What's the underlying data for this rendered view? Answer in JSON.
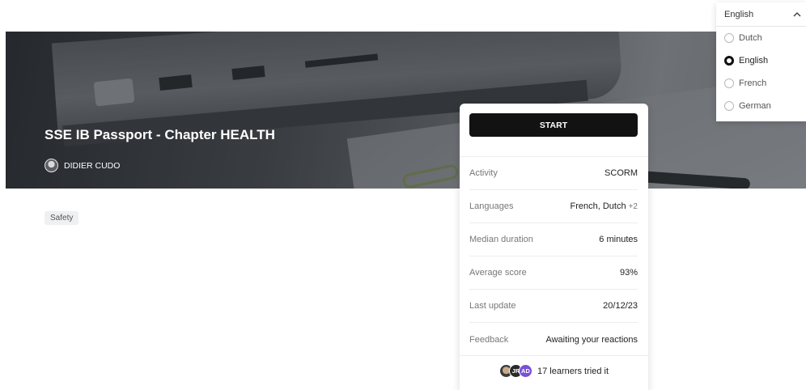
{
  "course": {
    "title": "SSE IB Passport - Chapter HEALTH",
    "author": "DIDIER CUDO",
    "tag": "Safety"
  },
  "card": {
    "start_label": "START",
    "rows": [
      {
        "key": "Activity",
        "value": "SCORM",
        "extra": ""
      },
      {
        "key": "Languages",
        "value": "French, Dutch",
        "extra": "+2"
      },
      {
        "key": "Median duration",
        "value": "6 minutes",
        "extra": ""
      },
      {
        "key": "Average score",
        "value": "93%",
        "extra": ""
      },
      {
        "key": "Last update",
        "value": "20/12/23",
        "extra": ""
      },
      {
        "key": "Feedback",
        "value": "Awaiting your reactions",
        "extra": ""
      }
    ],
    "learners": {
      "avatar_initials": [
        "JR",
        "AD"
      ],
      "label": "17 learners tried it"
    }
  },
  "language_dropdown": {
    "selected": "English",
    "options": [
      "Dutch",
      "English",
      "French",
      "German"
    ],
    "chevron": "^"
  },
  "colors": {
    "primary_button": "#121212",
    "avatar_ad": "#7a4fd6"
  }
}
